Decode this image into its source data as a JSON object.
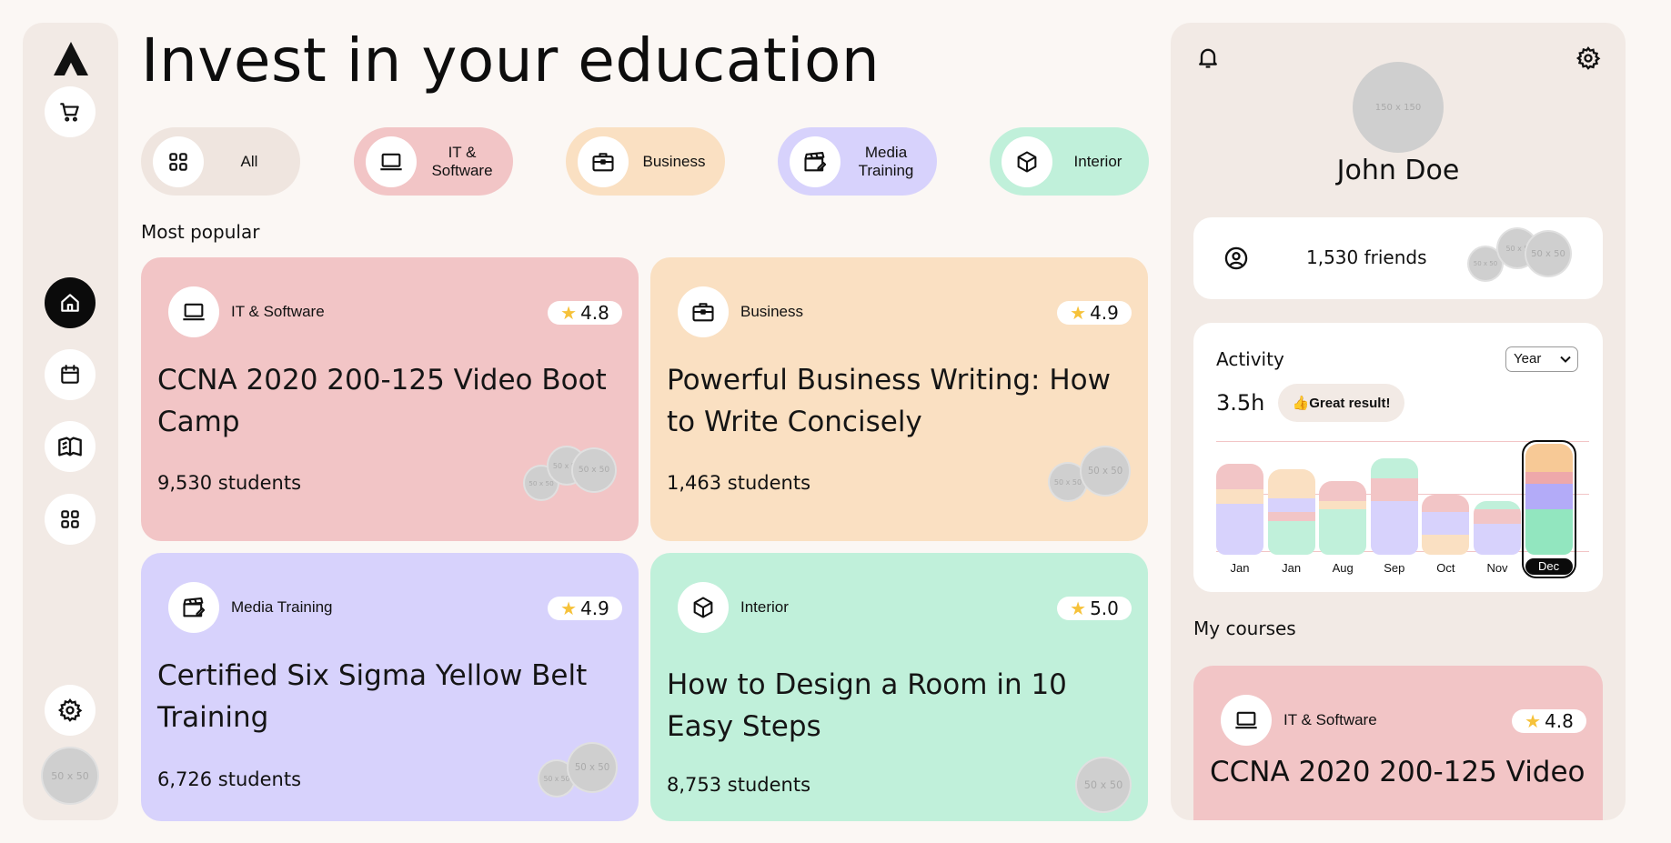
{
  "page": {
    "title": "Invest in your education"
  },
  "sidebar": {
    "items": [
      {
        "icon": "cart-icon"
      },
      {
        "icon": "home-icon",
        "active": true
      },
      {
        "icon": "calendar-icon"
      },
      {
        "icon": "book-icon"
      },
      {
        "icon": "grid-icon"
      },
      {
        "icon": "gear-icon"
      }
    ],
    "avatar_placeholder": "50 x 50"
  },
  "categories": [
    {
      "label": "All",
      "icon": "grid-icon",
      "color": "#efe5df"
    },
    {
      "label": "IT & Software",
      "icon": "laptop-icon",
      "color": "#f2c5c6"
    },
    {
      "label": "Business",
      "icon": "briefcase-icon",
      "color": "#fae0c2"
    },
    {
      "label": "Media Training",
      "icon": "clapperboard-icon",
      "color": "#d7d2fc"
    },
    {
      "label": "Interior",
      "icon": "cube-icon",
      "color": "#c0f0da"
    }
  ],
  "most_popular": {
    "label": "Most popular",
    "cards": [
      {
        "category": "IT & Software",
        "icon": "laptop-icon",
        "rating": "4.8",
        "title": "CCNA 2020 200-125 Video Boot Camp",
        "students": "9,530 students",
        "color": "#f2c5c6",
        "avatars": [
          "50 x 50",
          "50 x 50",
          "50 x 50"
        ]
      },
      {
        "category": "Business",
        "icon": "briefcase-icon",
        "rating": "4.9",
        "title": "Powerful Business Writing: How to Write Concisely",
        "students": "1,463 students",
        "color": "#fae0c2",
        "avatars": [
          "50 x 50",
          "50 x 50"
        ]
      },
      {
        "category": "Media Training",
        "icon": "clapperboard-icon",
        "rating": "4.9",
        "title": "Certified Six Sigma Yellow Belt Training",
        "students": "6,726 students",
        "color": "#d7d2fc",
        "avatars": [
          "50 x 50",
          "50 x 50"
        ]
      },
      {
        "category": "Interior",
        "icon": "cube-icon",
        "rating": "5.0",
        "title": "How to Design a Room in 10 Easy Steps",
        "students": "8,753 students",
        "color": "#c0f0da",
        "avatars": [
          "50 x 50"
        ]
      }
    ]
  },
  "profile": {
    "bell_icon": "bell-icon",
    "settings_icon": "gear-icon",
    "avatar_placeholder": "150 x 150",
    "name": "John Doe",
    "friends": "1,530 friends",
    "friend_avatars": [
      "50 x 50",
      "50 x 5",
      "50 x 50"
    ]
  },
  "activity": {
    "title": "Activity",
    "period_select": "Year",
    "hours": "3.5h",
    "badge": "👍Great result!",
    "colors": {
      "pink": "#f2c5c6",
      "peach": "#fae0c2",
      "lavender": "#d7d2fc",
      "mint": "#c0f0da",
      "selected_pink": "#eea8aa",
      "selected_peach": "#f7c996",
      "selected_lav": "#b3abf8",
      "selected_mint": "#92e6bf"
    },
    "months": [
      {
        "label": "Jan",
        "total": 3.2,
        "segments": [
          {
            "c": "pink",
            "v": 0.9
          },
          {
            "c": "peach",
            "v": 0.5
          },
          {
            "c": "lavender",
            "v": 1.8
          }
        ]
      },
      {
        "label": "Jan",
        "total": 3.0,
        "segments": [
          {
            "c": "peach",
            "v": 1.0
          },
          {
            "c": "lavender",
            "v": 0.5
          },
          {
            "c": "pink",
            "v": 0.3
          },
          {
            "c": "mint",
            "v": 1.2
          }
        ]
      },
      {
        "label": "Aug",
        "total": 2.6,
        "segments": [
          {
            "c": "pink",
            "v": 0.7
          },
          {
            "c": "peach",
            "v": 0.3
          },
          {
            "c": "mint",
            "v": 1.6
          }
        ]
      },
      {
        "label": "Sep",
        "total": 3.4,
        "segments": [
          {
            "c": "mint",
            "v": 0.7
          },
          {
            "c": "pink",
            "v": 0.8
          },
          {
            "c": "lavender",
            "v": 1.9
          }
        ]
      },
      {
        "label": "Oct",
        "total": 2.1,
        "segments": [
          {
            "c": "pink",
            "v": 0.6
          },
          {
            "c": "lavender",
            "v": 0.8
          },
          {
            "c": "peach",
            "v": 0.7
          }
        ]
      },
      {
        "label": "Nov",
        "total": 1.9,
        "segments": [
          {
            "c": "mint",
            "v": 0.3
          },
          {
            "c": "pink",
            "v": 0.5
          },
          {
            "c": "lavender",
            "v": 1.1
          }
        ]
      },
      {
        "label": "Dec",
        "total": 3.9,
        "selected": true,
        "segments": [
          {
            "c": "selected_peach",
            "v": 1.0
          },
          {
            "c": "selected_pink",
            "v": 0.4
          },
          {
            "c": "selected_lav",
            "v": 0.9
          },
          {
            "c": "selected_mint",
            "v": 1.6
          }
        ]
      }
    ],
    "max": 4.0
  },
  "my_courses": {
    "label": "My courses",
    "card": {
      "category": "IT & Software",
      "icon": "laptop-icon",
      "rating": "4.8",
      "title": "CCNA 2020 200-125 Video",
      "color": "#f2c5c6"
    }
  }
}
